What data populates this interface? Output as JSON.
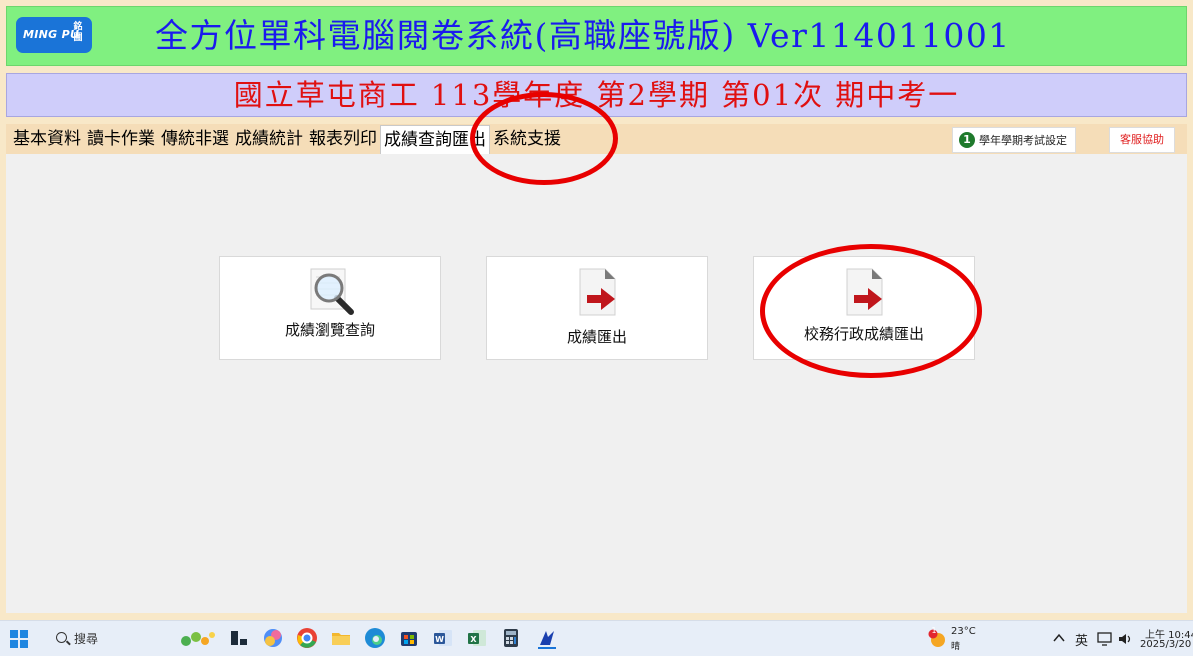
{
  "app": {
    "logo_text": "MING PU",
    "logo_mark": "銘圃",
    "title": "全方位單科電腦閱卷系統(高職座號版) Ver114011001",
    "school_line": "國立草屯商工 113學年度 第2學期 第01次 期中考一"
  },
  "menu": {
    "tabs": [
      "基本資料",
      "讀卡作業",
      "傳統非選",
      "成績統計",
      "報表列印",
      "成績查詢匯出",
      "系統支援"
    ],
    "active_tab": "成績查詢匯出",
    "term_setting_label": "學年學期考試設定",
    "term_icon_glyph": "1",
    "support_label": "客服協助"
  },
  "cards": [
    {
      "label": "成績瀏覽查詢",
      "icon": "magnifier-document-icon"
    },
    {
      "label": "成績匯出",
      "icon": "document-export-arrow-icon"
    },
    {
      "label": "校務行政成績匯出",
      "icon": "document-export-arrow-icon"
    }
  ],
  "taskbar": {
    "search_placeholder": "搜尋",
    "weather_temp": "23°C",
    "weather_desc": "晴",
    "weather_badge": "1",
    "ime_label": "英",
    "time": "上午 10:44",
    "date": "2025/3/20"
  },
  "colors": {
    "title_bg": "#80f080",
    "title_text": "#1a1aee",
    "school_bg": "#cfcdfa",
    "school_text": "#e01010",
    "menu_bg": "#f5ddb8",
    "annotation": "#e80000"
  }
}
